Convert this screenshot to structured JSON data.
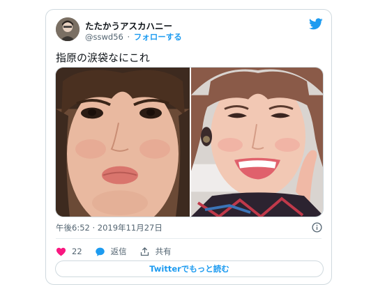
{
  "author": {
    "display_name": "たたかうアスカハニー",
    "handle": "@sswd56",
    "separator": "·",
    "follow_label": "フォローする"
  },
  "tweet": {
    "text": "指原の涙袋なにこれ",
    "timestamp": "午後6:52 · 2019年11月27日"
  },
  "actions": {
    "like_count": "22",
    "reply_label": "返信",
    "share_label": "共有"
  },
  "read_more_label": "Twitterでもっと読む",
  "colors": {
    "accent": "#1d9bf0",
    "like": "#f91880",
    "muted": "#536471",
    "border": "#cfd9de"
  },
  "icons": [
    "twitter-bird-icon",
    "info-icon",
    "heart-icon",
    "reply-icon",
    "share-icon"
  ]
}
